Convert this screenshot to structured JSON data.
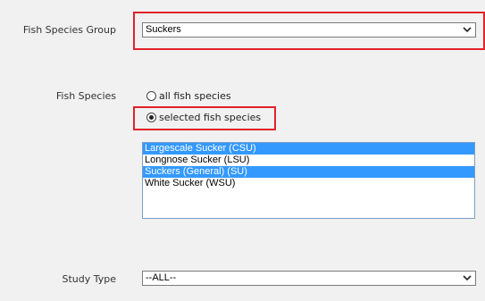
{
  "fish_species_group": {
    "label": "Fish Species Group",
    "selected": "Suckers"
  },
  "fish_species": {
    "label": "Fish Species",
    "option_all": "all fish species",
    "option_selected": "selected fish species",
    "checked": "selected fish species",
    "list": [
      {
        "text": "Largescale Sucker (CSU)",
        "selected": true
      },
      {
        "text": "Longnose Sucker (LSU)",
        "selected": false
      },
      {
        "text": "Suckers (General) (SU)",
        "selected": true
      },
      {
        "text": "White Sucker (WSU)",
        "selected": false
      }
    ]
  },
  "study_type": {
    "label": "Study Type",
    "selected": "--ALL--"
  },
  "colors": {
    "highlight": "#e1222a",
    "selection": "#3399ff",
    "background": "#f1f1f1"
  }
}
